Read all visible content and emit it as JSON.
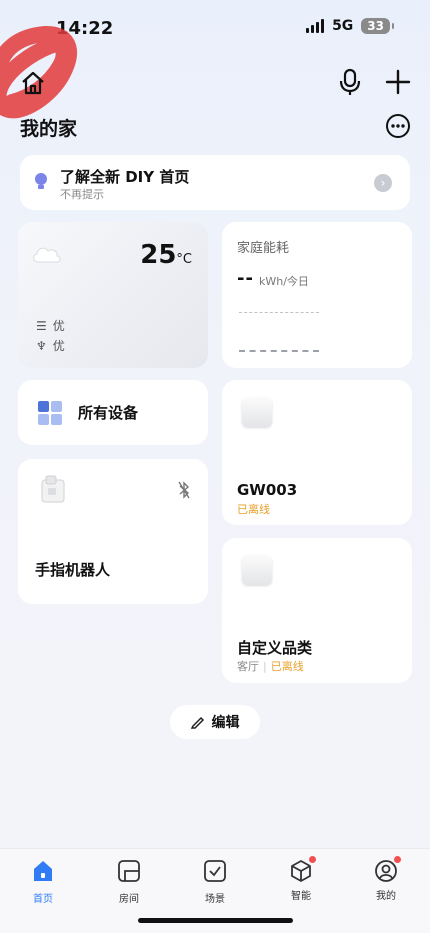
{
  "status": {
    "time": "14:22",
    "network": "5G",
    "battery": "33"
  },
  "header": {
    "title": "我的家"
  },
  "banner": {
    "title": "了解全新 DIY 首页",
    "subtitle": "不再提示"
  },
  "weather": {
    "temp": "25",
    "unit": "°C",
    "row1": "优",
    "row2": "优"
  },
  "energy": {
    "title": "家庭能耗",
    "value": "--",
    "unit": "kWh/今日"
  },
  "all_devices": {
    "label": "所有设备"
  },
  "devices": [
    {
      "name": "手指机器人"
    },
    {
      "name": "GW003",
      "status": "已离线"
    },
    {
      "name": "自定义品类",
      "room": "客厅",
      "status": "已离线"
    }
  ],
  "edit": {
    "label": "编辑"
  },
  "tabs": [
    {
      "label": "首页",
      "icon": "home-tab-icon",
      "active": true
    },
    {
      "label": "房间",
      "icon": "room-tab-icon"
    },
    {
      "label": "场景",
      "icon": "scene-tab-icon"
    },
    {
      "label": "智能",
      "icon": "smart-tab-icon",
      "badge": true
    },
    {
      "label": "我的",
      "icon": "profile-tab-icon",
      "badge": true
    }
  ],
  "colors": {
    "accent": "#2f7cf6",
    "offline": "#e7a02a",
    "badge": "#f05050"
  }
}
